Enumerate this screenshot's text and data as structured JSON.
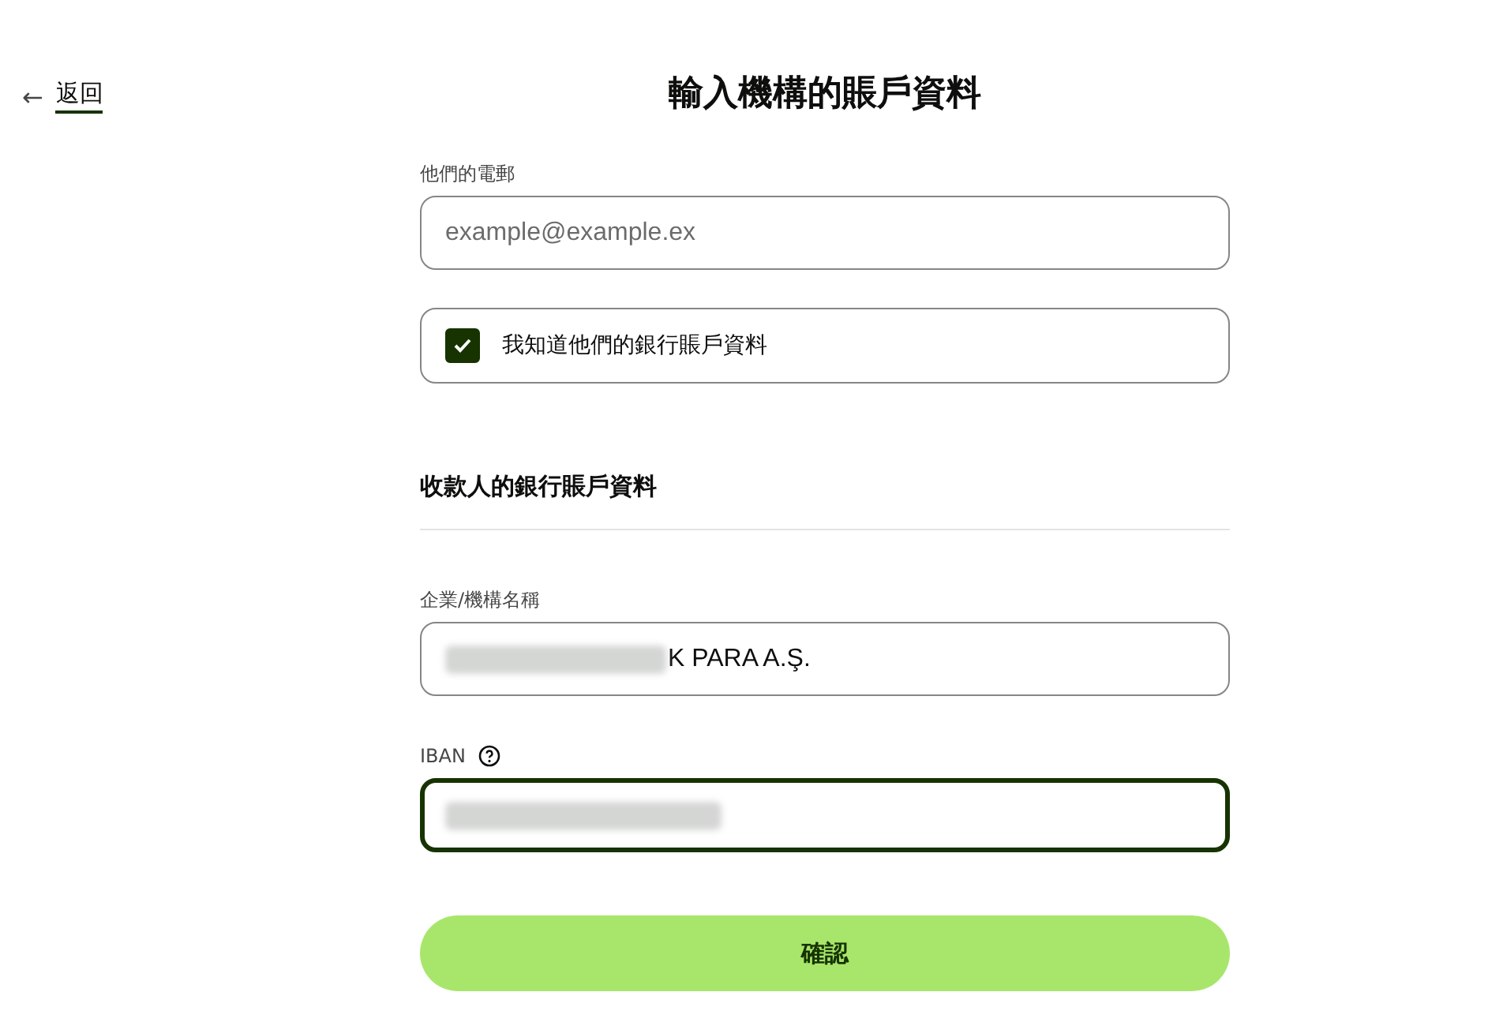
{
  "back_link": {
    "icon": "←",
    "label": "返回"
  },
  "title": "輸入機構的賬戶資料",
  "email_field": {
    "label": "他們的電郵",
    "placeholder": "example@example.ex",
    "focused": false
  },
  "know_bank_details": {
    "label": "我知道他們的銀行賬戶資料",
    "checked": true
  },
  "section_heading": "收款人的銀行賬戶資料",
  "fields": [
    {
      "label": "企業/機構名稱",
      "value": "K PARA A.Ş.",
      "redacted": true,
      "help": false,
      "focused": false
    },
    {
      "label": "IBAN",
      "redacted": true,
      "help": true,
      "focused": true
    }
  ],
  "confirm_button": "確認"
}
